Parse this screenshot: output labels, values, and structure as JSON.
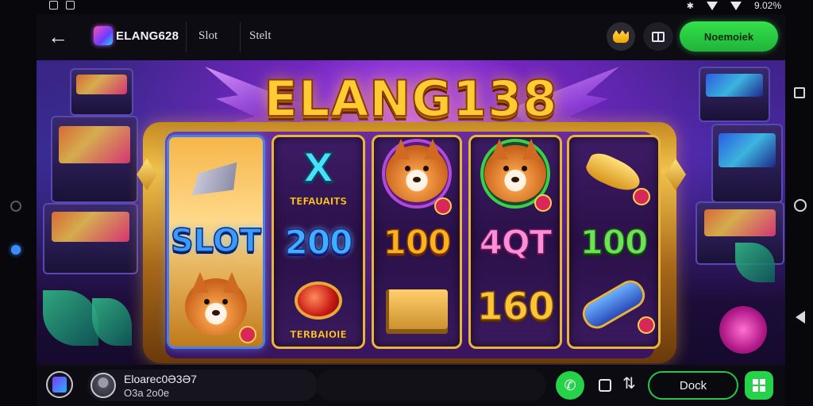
{
  "status_bar": {
    "time": "9.02%"
  },
  "top_bar": {
    "app_title": "ELANG628",
    "tab_1": "Slot",
    "tab_2": "Stelt",
    "cta_label": "Noemoiek"
  },
  "hero": {
    "brand_title": "ELANG138",
    "reels": [
      {
        "top_symbol": "crystal-dagger",
        "middle_label": "SLOT",
        "bottom_symbol": "cat"
      },
      {
        "top_label": "X",
        "top_caption": "TEFAUAITS",
        "middle_label": "200",
        "bottom_caption": "TERBAIOIE"
      },
      {
        "top_symbol": "cat",
        "middle_label": "100",
        "bottom_symbol": "gold-crate"
      },
      {
        "top_symbol": "cat",
        "middle_label": "4QT",
        "bottom_label": "160"
      },
      {
        "top_symbol": "golden-horn",
        "middle_label": "100",
        "bottom_symbol": "blue-scroll"
      }
    ]
  },
  "bottom_bar": {
    "user_name": "Eloarec0Ə3Ə7",
    "user_sub": "O3a 2o0e",
    "dock_label": "Dock"
  },
  "colors": {
    "accent_green": "#25d24a",
    "title_gold": "#ffcc33",
    "hero_purple": "#3a1f78"
  }
}
